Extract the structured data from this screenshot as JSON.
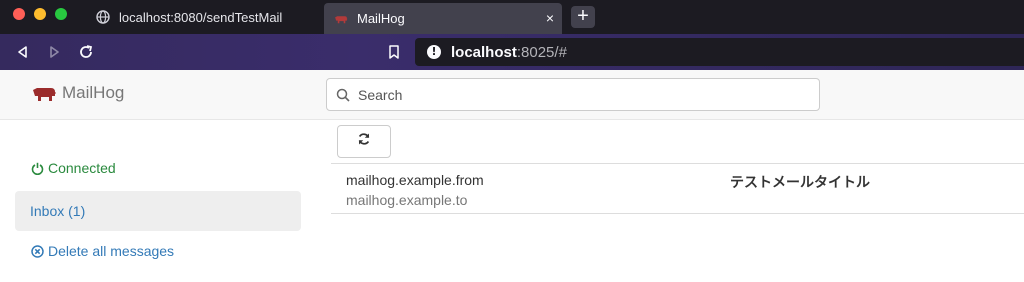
{
  "browser": {
    "tabs": [
      {
        "title": "localhost:8080/sendTestMail",
        "icon": "globe-icon",
        "active": false
      },
      {
        "title": "MailHog",
        "icon": "mailhog-pig-icon",
        "active": true
      }
    ],
    "close_glyph": "×",
    "new_tab_glyph": "+",
    "url": {
      "host": "localhost",
      "rest": ":8025/#"
    },
    "colors": {
      "tab_strip": "#1c1b22",
      "toolbar": "#352a5e",
      "active_tab": "#42414d"
    }
  },
  "app": {
    "brand": "MailHog",
    "brand_color": "#9b2c2c",
    "search": {
      "placeholder": "Search",
      "value": ""
    }
  },
  "sidebar": {
    "status": {
      "label": "Connected",
      "icon": "power-icon",
      "color": "#2a8a3e"
    },
    "inbox": {
      "label": "Inbox (1)"
    },
    "delete_all": {
      "label": "Delete all messages",
      "icon": "times-circle-icon"
    }
  },
  "toolbar": {
    "refresh_icon": "refresh-icon"
  },
  "messages": [
    {
      "from": "mailhog.example.from",
      "to": "mailhog.example.to",
      "subject": "テストメールタイトル"
    }
  ]
}
